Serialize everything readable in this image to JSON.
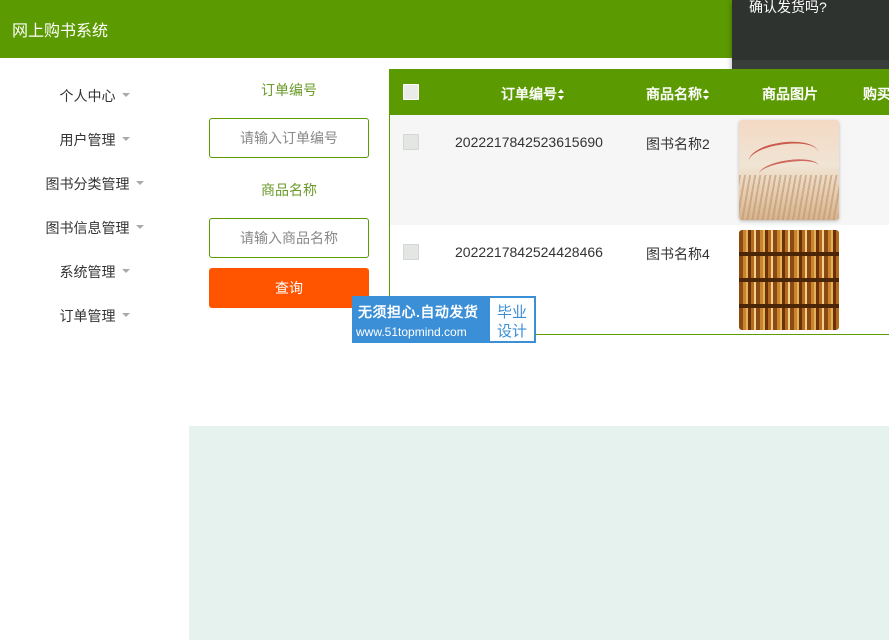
{
  "header": {
    "title": "网上购书系统"
  },
  "confirm_popup": {
    "message": "确认发货吗?"
  },
  "sidebar": {
    "items": [
      {
        "label": "个人中心"
      },
      {
        "label": "用户管理"
      },
      {
        "label": "图书分类管理"
      },
      {
        "label": "图书信息管理"
      },
      {
        "label": "系统管理"
      },
      {
        "label": "订单管理"
      }
    ]
  },
  "search": {
    "order_no_label": "订单编号",
    "order_no_placeholder": "请输入订单编号",
    "order_no_value": "",
    "product_name_label": "商品名称",
    "product_name_placeholder": "请输入商品名称",
    "product_name_value": "",
    "query_button": "查询"
  },
  "table": {
    "columns": [
      "订单编号",
      "商品名称",
      "商品图片",
      "购买"
    ],
    "rows": [
      {
        "order_no": "2022217842523615690",
        "product_name": "图书名称2",
        "image": "book-cover-flowers"
      },
      {
        "order_no": "2022217842524428466",
        "product_name": "图书名称4",
        "image": "bookshelf-photo"
      }
    ]
  },
  "watermark": {
    "line1": "无须担心.自动发货",
    "line2": "www.51topmind.com",
    "badge_line1": "毕业",
    "badge_line2": "设计",
    "color": "#3a8fd6"
  },
  "colors": {
    "brand": "#5b9a00",
    "query_button": "#ff5500",
    "bottom_area": "#e5f2ed"
  }
}
